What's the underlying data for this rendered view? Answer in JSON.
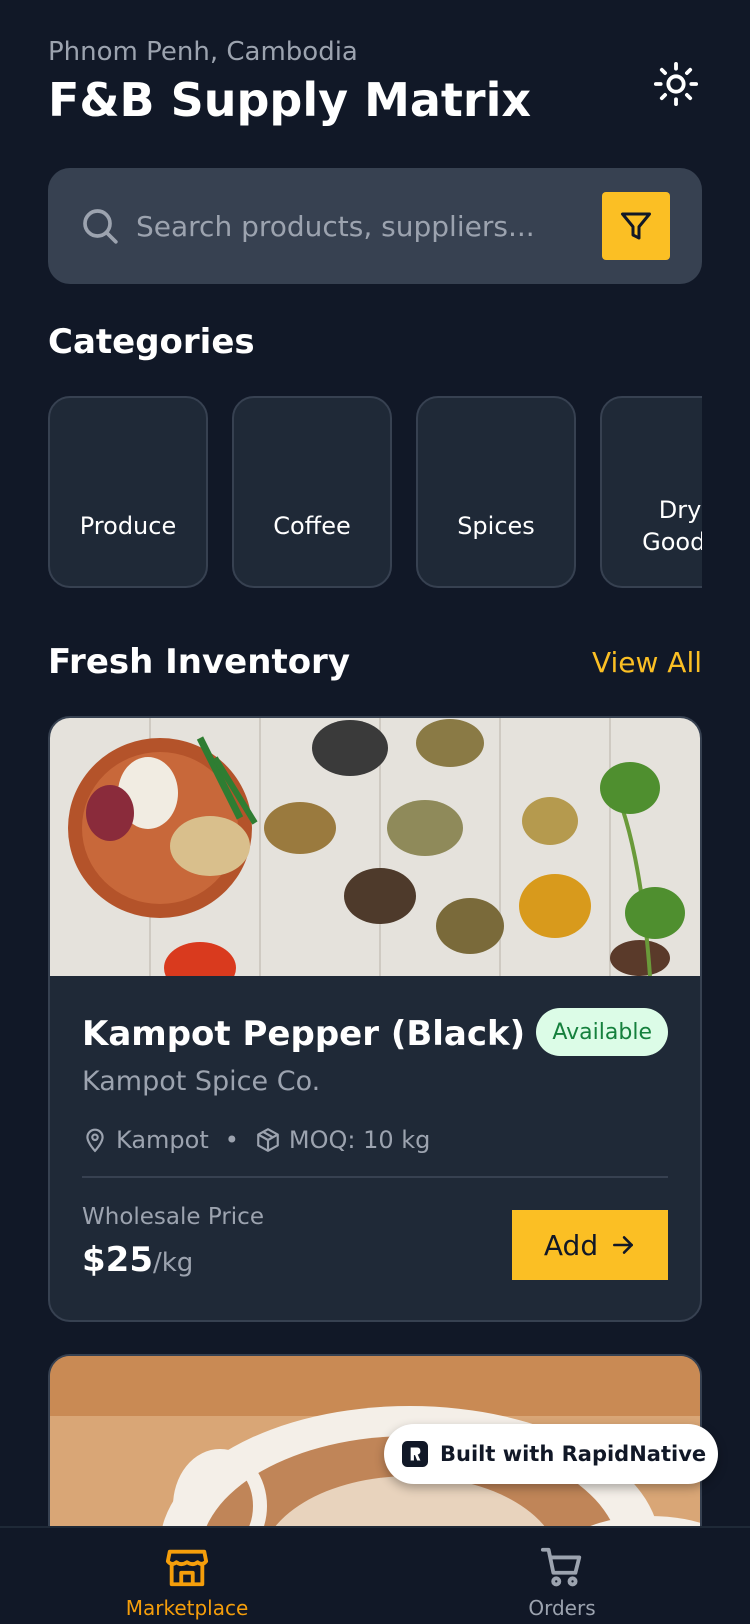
{
  "header": {
    "location": "Phnom Penh, Cambodia",
    "title": "F&B Supply Matrix",
    "theme_icon": "sun-icon"
  },
  "search": {
    "placeholder": "Search products, suppliers...",
    "filter_icon": "filter-icon"
  },
  "categories": {
    "title": "Categories",
    "items": [
      {
        "label": "Produce"
      },
      {
        "label": "Coffee"
      },
      {
        "label": "Spices"
      },
      {
        "label": "Dry Goods"
      }
    ]
  },
  "inventory": {
    "title": "Fresh Inventory",
    "view_all": "View All",
    "products": [
      {
        "name": "Kampot Pepper (Black)",
        "status": "Available",
        "supplier": "Kampot Spice Co.",
        "location": "Kampot",
        "moq": "MOQ: 10 kg",
        "price_label": "Wholesale Price",
        "price": "$25",
        "unit": "/kg",
        "action": "Add"
      }
    ]
  },
  "badge": {
    "text": "Built with RapidNative"
  },
  "tabs": [
    {
      "label": "Marketplace",
      "icon": "store-icon",
      "active": true
    },
    {
      "label": "Orders",
      "icon": "cart-icon",
      "active": false
    }
  ],
  "colors": {
    "background": "#111827",
    "card": "#1f2937",
    "accent": "#fbbf24",
    "muted": "#9ca3af",
    "available_bg": "#dcfce7",
    "available_text": "#15803d"
  }
}
